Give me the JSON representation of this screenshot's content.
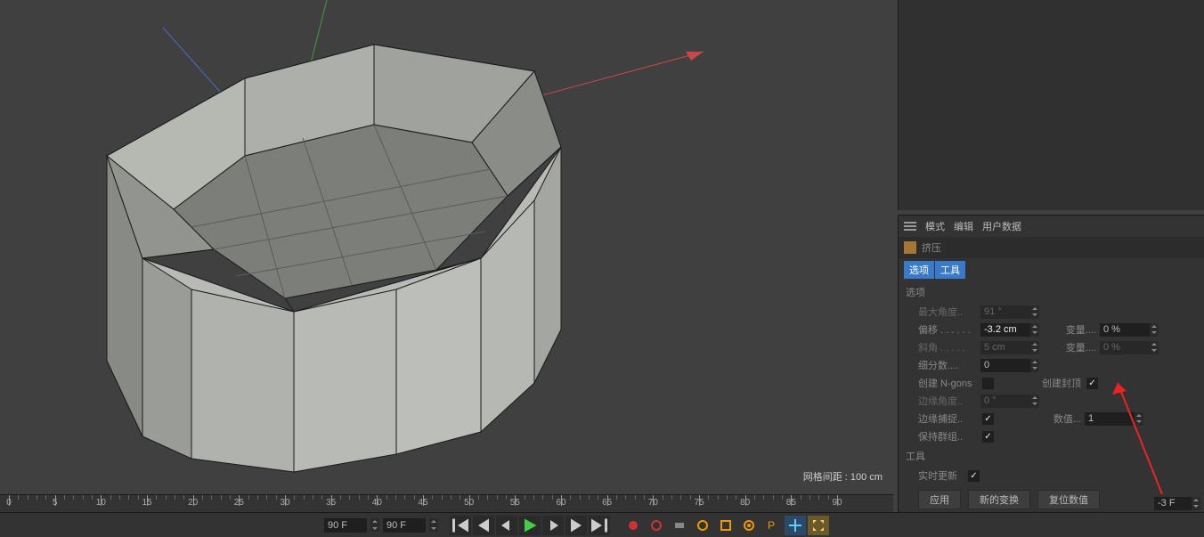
{
  "viewport": {
    "grid_label": "网格间距 : 100 cm"
  },
  "attr_menu": {
    "mode": "模式",
    "edit": "编辑",
    "user_data": "用户数据"
  },
  "tool": {
    "name": "挤压"
  },
  "tabs": {
    "options": "选项",
    "tool": "工具"
  },
  "options": {
    "title": "选项",
    "max_angle": {
      "label": "最大角度..",
      "value": "91 °"
    },
    "offset": {
      "label": "偏移 . . . . . .",
      "value": "-3.2 cm",
      "var_label": "变量....",
      "var_value": "0 %"
    },
    "bevel": {
      "label": "斜角 . . . . .",
      "value": "5 cm",
      "var_label": "变量....",
      "var_value": "0 %"
    },
    "subdiv": {
      "label": "细分数....",
      "value": "0"
    },
    "ngons": {
      "label": "创建 N-gons",
      "checked": false,
      "cap_label": "创建封顶",
      "cap_checked": true
    },
    "edge_angle": {
      "label": "边缘角度..",
      "value": "0 °"
    },
    "edge_snap": {
      "label": "边缘捕捉..",
      "checked": true,
      "count_label": "数值...",
      "count_value": "1"
    },
    "keep_groups": {
      "label": "保持群组..",
      "checked": true
    }
  },
  "tool_section": {
    "title": "工具",
    "realtime": {
      "label": "实时更新",
      "checked": true
    },
    "apply": "应用",
    "new_transform": "新的变换",
    "reset": "复位数值"
  },
  "timeline": {
    "ticks": [
      0,
      5,
      10,
      15,
      20,
      25,
      30,
      35,
      40,
      45,
      50,
      55,
      60,
      65,
      70,
      75,
      80,
      85,
      90
    ],
    "current_frame_display": "-3 F",
    "frame_start": "90 F",
    "frame_end": "90 F"
  }
}
